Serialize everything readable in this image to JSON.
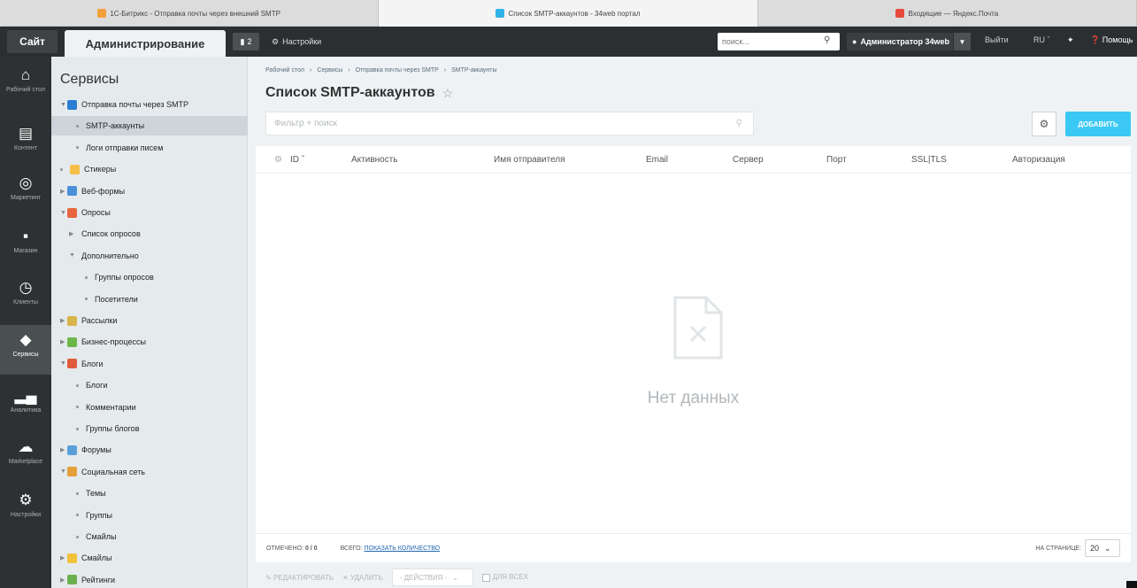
{
  "browser_tabs": [
    {
      "title": "1С-Битрикс - Отправка почты через внешний SMTP",
      "color": "#f2a13a"
    },
    {
      "title": "Список SMTP-аккаунтов - 34web портал",
      "color": "#2fb2e8"
    },
    {
      "title": "Входящие — Яндекс.Почта",
      "color": "#e84a3c"
    }
  ],
  "topbar": {
    "site_label": "Сайт",
    "admin_label": "Администрирование",
    "notify_count": "2",
    "settings_label": "Настройки",
    "search_placeholder": "поиск...",
    "user_label": "Администратор 34web",
    "logout_label": "Выйти",
    "lang_label": "RU",
    "help_label": "Помощь"
  },
  "rail": [
    {
      "label": "Рабочий стол",
      "icon": "home-icon"
    },
    {
      "label": "Контент",
      "icon": "document-icon"
    },
    {
      "label": "Маркетинг",
      "icon": "target-icon"
    },
    {
      "label": "Магазин",
      "icon": "basket-icon"
    },
    {
      "label": "Клиенты",
      "icon": "clock-24-icon"
    },
    {
      "label": "Сервисы",
      "icon": "layers-icon"
    },
    {
      "label": "Аналитика",
      "icon": "bar-chart-icon"
    },
    {
      "label": "Marketplace",
      "icon": "cloud-download-icon"
    },
    {
      "label": "Настройки",
      "icon": "gear-icon"
    }
  ],
  "menu": {
    "title": "Сервисы",
    "items": [
      {
        "label": "Отправка почты через SMTP",
        "level": 0,
        "arrow": "▼",
        "icon_color": "#2a7fd4"
      },
      {
        "label": "SMTP-аккаунты",
        "level": 1,
        "arrow": "",
        "icon_color": ""
      },
      {
        "label": "Логи отправки писем",
        "level": 1,
        "arrow": "",
        "icon_color": ""
      },
      {
        "label": "Стикеры",
        "level": 0,
        "arrow": "",
        "icon_color": "#f5c04a"
      },
      {
        "label": "Веб-формы",
        "level": 0,
        "arrow": "▶",
        "icon_color": "#4a90d9"
      },
      {
        "label": "Опросы",
        "level": 0,
        "arrow": "▼",
        "icon_color": "#e8643c"
      },
      {
        "label": "Список опросов",
        "level": 1,
        "arrow": "▶",
        "icon_color": ""
      },
      {
        "label": "Дополнительно",
        "level": 1,
        "arrow": "▼",
        "icon_color": ""
      },
      {
        "label": "Группы опросов",
        "level": 2,
        "arrow": "",
        "icon_color": ""
      },
      {
        "label": "Посетители",
        "level": 2,
        "arrow": "",
        "icon_color": ""
      },
      {
        "label": "Рассылки",
        "level": 0,
        "arrow": "▶",
        "icon_color": "#d9b44a"
      },
      {
        "label": "Бизнес-процессы",
        "level": 0,
        "arrow": "▶",
        "icon_color": "#6bb84a"
      },
      {
        "label": "Блоги",
        "level": 0,
        "arrow": "▼",
        "icon_color": "#e05a3a"
      },
      {
        "label": "Блоги",
        "level": 1,
        "arrow": "",
        "icon_color": ""
      },
      {
        "label": "Комментарии",
        "level": 1,
        "arrow": "",
        "icon_color": ""
      },
      {
        "label": "Группы блогов",
        "level": 1,
        "arrow": "",
        "icon_color": ""
      },
      {
        "label": "Форумы",
        "level": 0,
        "arrow": "▶",
        "icon_color": "#5aa0d8"
      },
      {
        "label": "Социальная сеть",
        "level": 0,
        "arrow": "▼",
        "icon_color": "#e4a03a"
      },
      {
        "label": "Темы",
        "level": 1,
        "arrow": "",
        "icon_color": ""
      },
      {
        "label": "Группы",
        "level": 1,
        "arrow": "",
        "icon_color": ""
      },
      {
        "label": "Смайлы",
        "level": 1,
        "arrow": "",
        "icon_color": ""
      },
      {
        "label": "Смайлы",
        "level": 0,
        "arrow": "▶",
        "icon_color": "#f2c23a"
      },
      {
        "label": "Рейтинги",
        "level": 0,
        "arrow": "▶",
        "icon_color": "#6ab04c"
      }
    ]
  },
  "breadcrumb": [
    "Рабочий стол",
    "Сервисы",
    "Отправка почты через SMTP",
    "SMTP-аккаунты"
  ],
  "page_title": "Список SMTP-аккаунтов",
  "filter_placeholder": "Фильтр + поиск",
  "add_button_label": "ДОБАВИТЬ",
  "columns": [
    "ID",
    "Активность",
    "Имя отправителя",
    "Email",
    "Сервер",
    "Порт",
    "SSL|TLS",
    "Авторизация"
  ],
  "empty_text": "Нет данных",
  "footer": {
    "checked_label": "ОТМЕЧЕНО:",
    "checked_value": "0 / 0",
    "total_label": "ВСЕГО:",
    "total_link": "ПОКАЗАТЬ КОЛИЧЕСТВО",
    "per_page_label": "НА СТРАНИЦЕ:",
    "per_page_value": "20"
  },
  "actions": {
    "edit_label": "РЕДАКТИРОВАТЬ",
    "delete_label": "УДАЛИТЬ",
    "actions_label": "- ДЕЙСТВИЯ -",
    "for_all_label": "ДЛЯ ВСЕХ"
  },
  "colors": {
    "accent": "#3bc8f5",
    "topbar": "#2c2f31",
    "rail": "#2e3133"
  }
}
